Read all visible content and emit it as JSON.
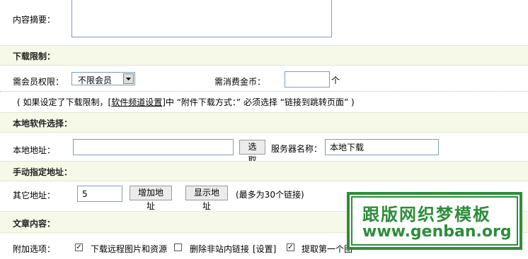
{
  "summary": {
    "label": "内容摘要："
  },
  "download_limit": {
    "section_title": "下载限制：",
    "member_label": "需会员权限：",
    "member_select": "不限会员",
    "coin_label": "需消费金币：",
    "coin_value": "",
    "coin_unit": "个",
    "note_prefix": "( 如果设定了下载限制，[",
    "note_link": "软件频道设置",
    "note_suffix": "]中 “附件下载方式：” 必须选择 “链接到跳转页面” )"
  },
  "local_software": {
    "section_title": "本地软件选择：",
    "address_label": "本地地址：",
    "address_value": "",
    "pick_button": "选取",
    "server_label": "服务器名称：",
    "server_value": "本地下载"
  },
  "manual_address": {
    "section_title": "手动指定地址：",
    "other_label": "其它地址：",
    "other_value": "5",
    "add_button": "增加地址",
    "show_button": "显示地址",
    "hint": "(最多为30个链接)"
  },
  "article": {
    "section_title": "文章内容：",
    "options_label": "附加选项：",
    "opt1": "下载远程图片和资源",
    "opt2": "删除非站内链接",
    "opt2_link": "[设置]",
    "opt3": "提取第一个图",
    "opt1_checked": true,
    "opt2_checked": false,
    "opt3_checked": true
  },
  "watermark": {
    "cn": "跟版网织梦模板",
    "en": "www.genban.org",
    "color": "#2d8d3a"
  }
}
